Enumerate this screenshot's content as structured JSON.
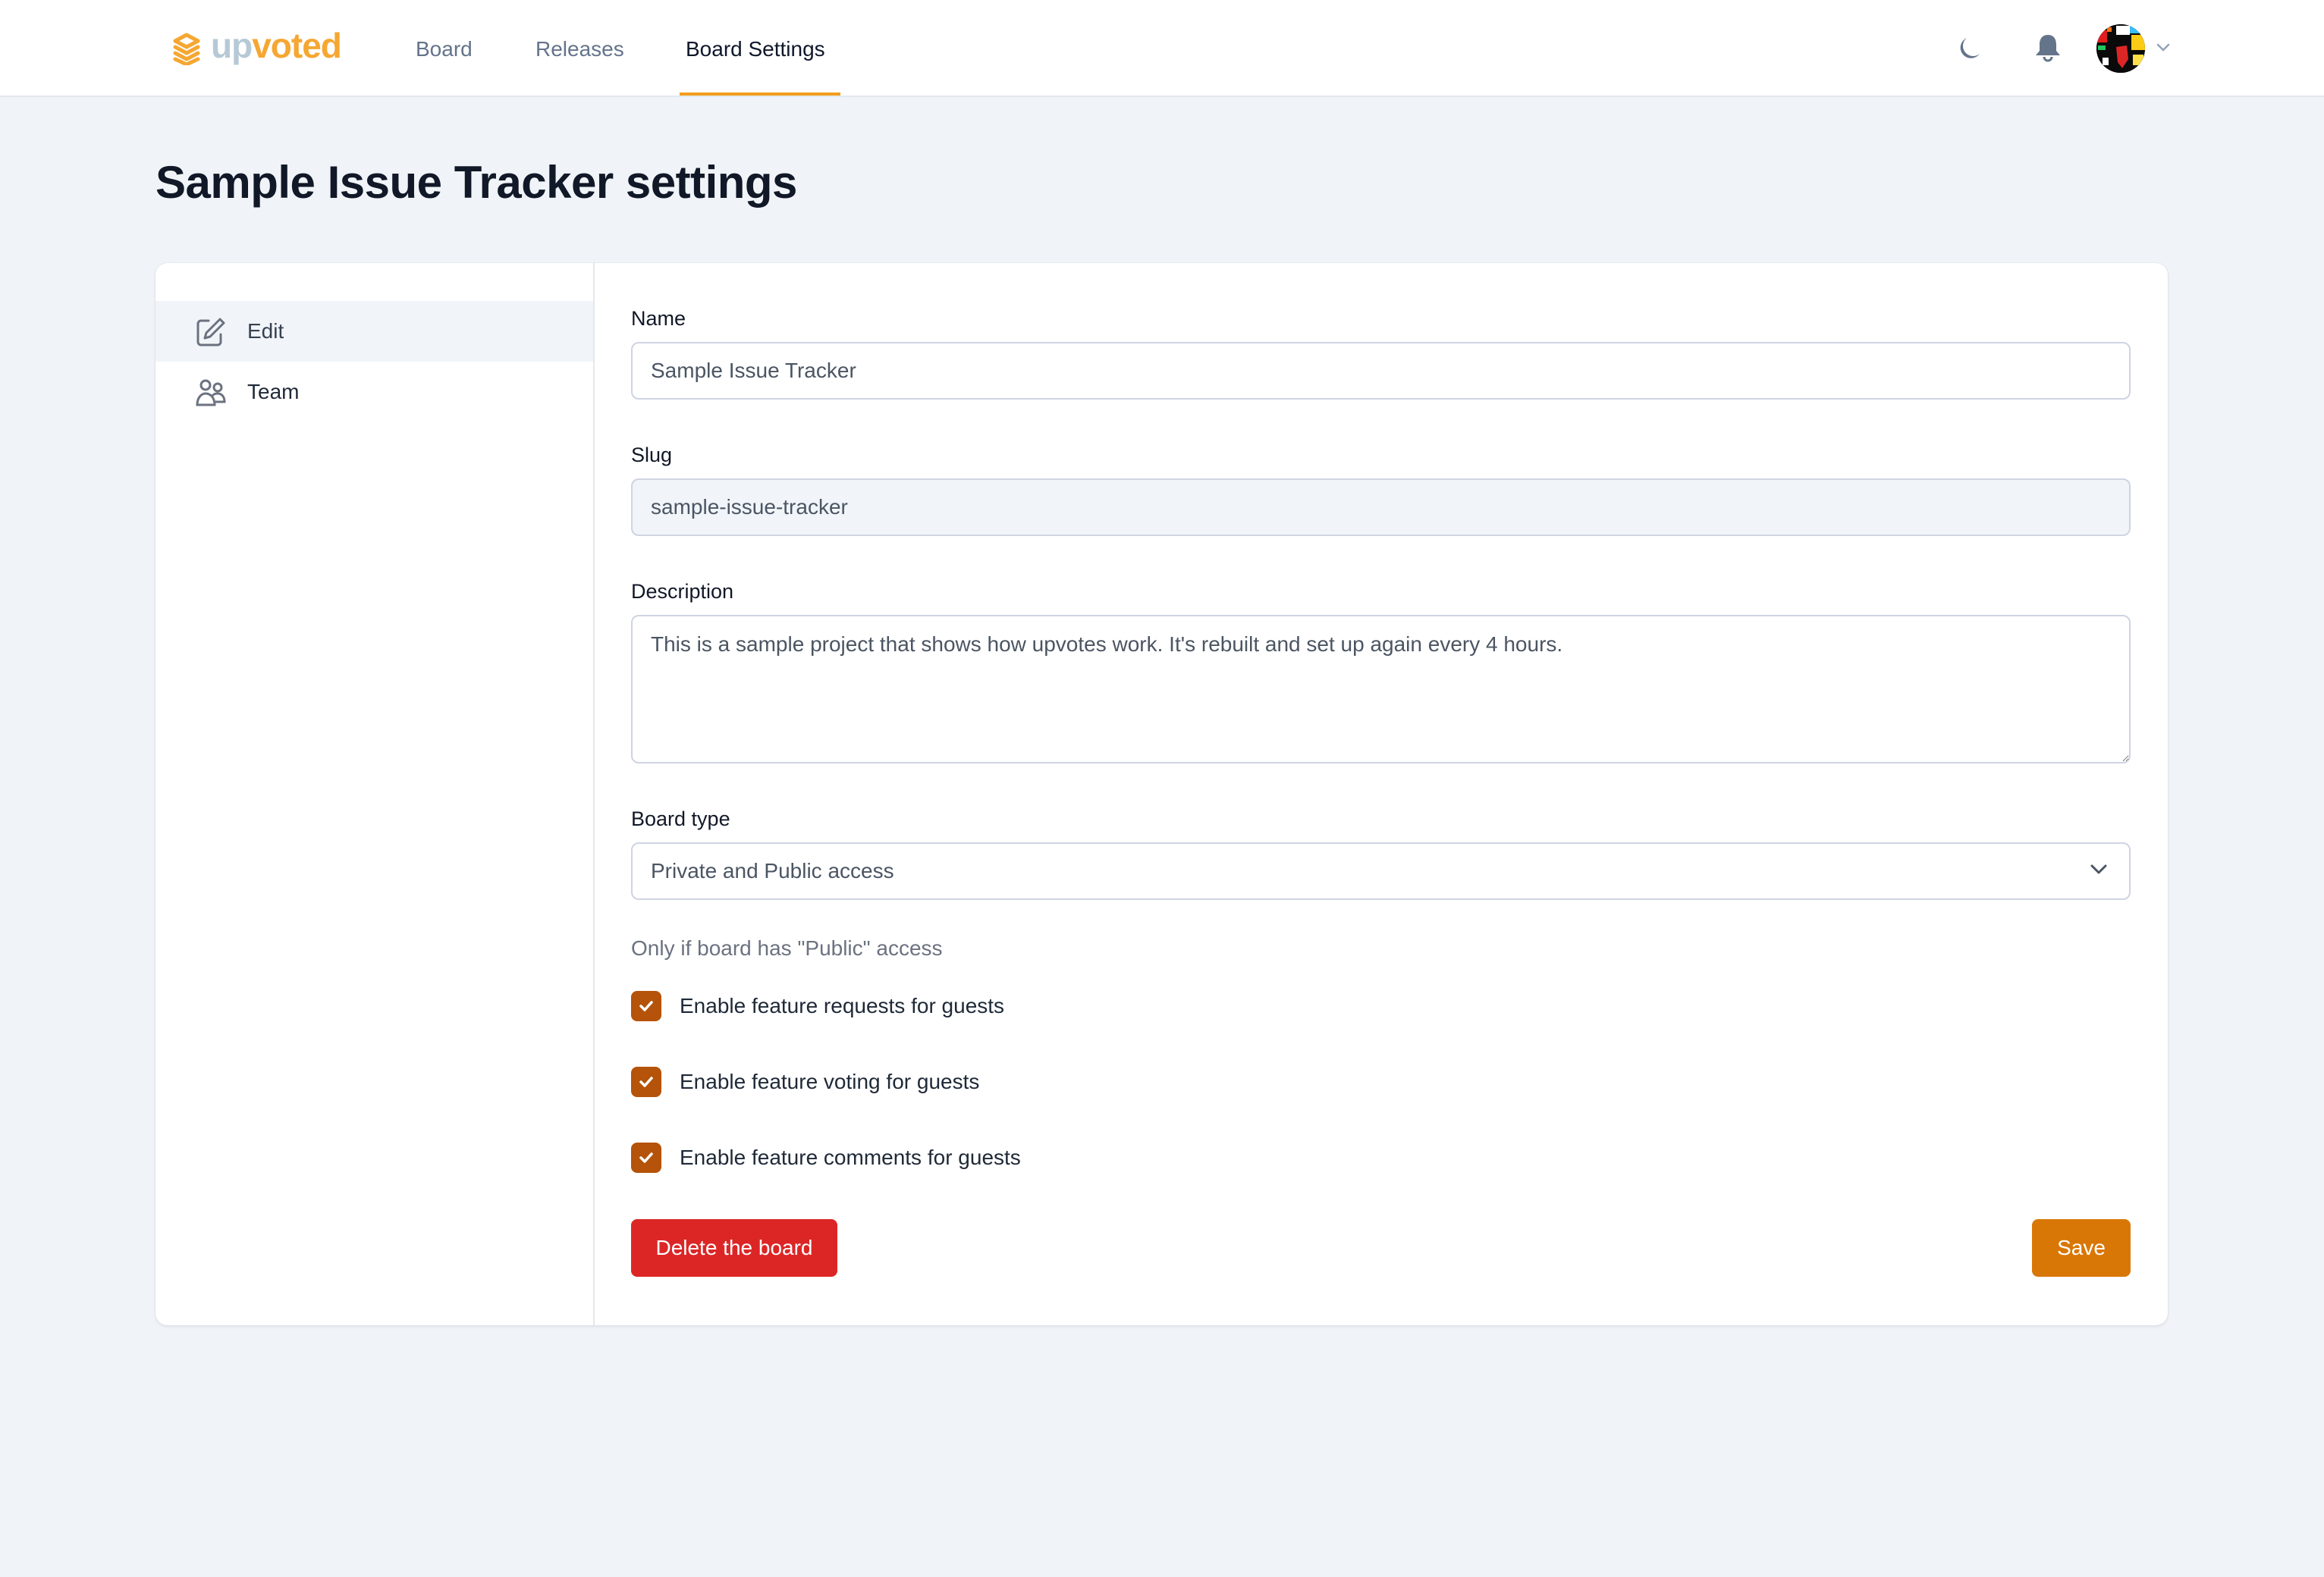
{
  "app": {
    "logo": {
      "prefix": "up",
      "suffix": "voted",
      "icon": "layers-icon"
    },
    "colors": {
      "accent": "#f29d1b",
      "logo_up": "#b6c9d6",
      "logo_voted": "#f5a732",
      "danger": "#dc2626",
      "save": "#d97706",
      "checkbox": "#b45309"
    }
  },
  "nav": {
    "items": [
      {
        "label": "Board",
        "active": false
      },
      {
        "label": "Releases",
        "active": false
      },
      {
        "label": "Board Settings",
        "active": true
      }
    ]
  },
  "header_actions": {
    "theme_toggle": "moon-icon",
    "notifications": "bell-icon",
    "user_menu": "avatar",
    "user_menu_chevron": "chevron-down-icon"
  },
  "page": {
    "title": "Sample Issue Tracker settings"
  },
  "sidebar": {
    "items": [
      {
        "label": "Edit",
        "icon": "pencil-square-icon",
        "active": true
      },
      {
        "label": "Team",
        "icon": "users-icon",
        "active": false
      }
    ]
  },
  "form": {
    "name": {
      "label": "Name",
      "value": "Sample Issue Tracker"
    },
    "slug": {
      "label": "Slug",
      "value": "sample-issue-tracker",
      "readonly": true
    },
    "description": {
      "label": "Description",
      "value": "This is a sample project that shows how upvotes work. It's rebuilt and set up again every 4 hours."
    },
    "board_type": {
      "label": "Board type",
      "value": "Private and Public access"
    },
    "public_hint": "Only if board has \"Public\" access",
    "checkboxes": [
      {
        "label": "Enable feature requests for guests",
        "checked": true
      },
      {
        "label": "Enable feature voting for guests",
        "checked": true
      },
      {
        "label": "Enable feature comments for guests",
        "checked": true
      }
    ],
    "delete_label": "Delete the board",
    "save_label": "Save"
  }
}
